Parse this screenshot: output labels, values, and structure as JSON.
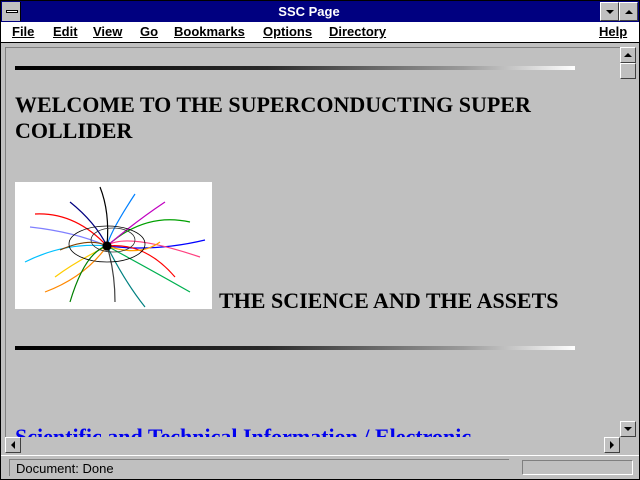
{
  "window": {
    "title": "SSC Page"
  },
  "menubar": {
    "items": [
      {
        "label": "File"
      },
      {
        "label": "Edit"
      },
      {
        "label": "View"
      },
      {
        "label": "Go"
      },
      {
        "label": "Bookmarks"
      },
      {
        "label": "Options"
      },
      {
        "label": "Directory"
      },
      {
        "label": "Help"
      }
    ]
  },
  "page": {
    "heading": "WELCOME TO THE SUPERCONDUCTING SUPER COLLIDER",
    "section_title": "THE SCIENCE AND THE ASSETS",
    "link_text": "Scientific and Technical Information / Electronic"
  },
  "status": {
    "text": "Document: Done",
    "progress": 0
  },
  "colors": {
    "titlebar": "#000080",
    "window_bg": "#c0c0c0",
    "link": "#0000ee"
  }
}
